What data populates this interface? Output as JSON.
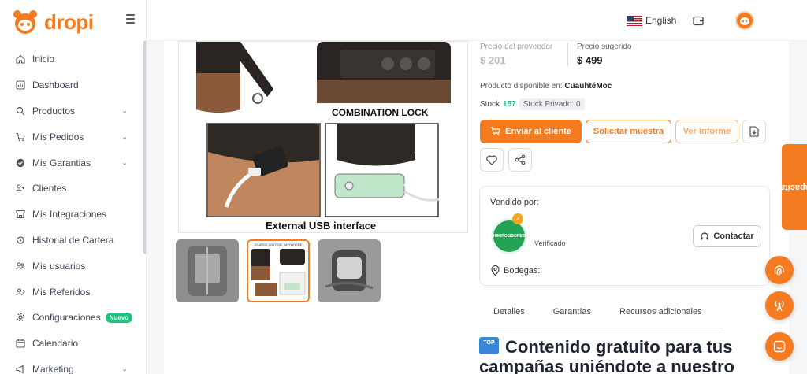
{
  "brand": {
    "name": "dropi"
  },
  "nav": {
    "items": [
      {
        "label": "Inicio",
        "icon": "home-icon",
        "chevron": false
      },
      {
        "label": "Dashboard",
        "icon": "dashboard-icon",
        "chevron": false
      },
      {
        "label": "Productos",
        "icon": "search-icon",
        "chevron": true
      },
      {
        "label": "Mis Pedidos",
        "icon": "cart-icon",
        "chevron": true
      },
      {
        "label": "Mis Garantias",
        "icon": "shield-check-icon",
        "chevron": true
      },
      {
        "label": "Clientes",
        "icon": "users-icon",
        "chevron": false
      },
      {
        "label": "Mis Integraciones",
        "icon": "store-icon",
        "chevron": false
      },
      {
        "label": "Historial de Cartera",
        "icon": "history-icon",
        "chevron": false
      },
      {
        "label": "Mis usuarios",
        "icon": "user-group-icon",
        "chevron": false
      },
      {
        "label": "Mis Referidos",
        "icon": "referral-icon",
        "chevron": false
      },
      {
        "label": "Configuraciones",
        "icon": "gear-icon",
        "chevron": false,
        "badge": "Nuevo"
      },
      {
        "label": "Calendario",
        "icon": "calendar-icon",
        "chevron": false
      },
      {
        "label": "Marketing",
        "icon": "megaphone-icon",
        "chevron": true
      }
    ]
  },
  "topbar": {
    "language": "English"
  },
  "product": {
    "image_captions": {
      "lock": "COMBINATION LOCK",
      "usb": "External USB interface"
    },
    "thumb2_caption": "CHARGE ANYTIME, ANYWHERE",
    "supplier_price_label": "Precio del proveedor",
    "supplier_price": "$ 201",
    "suggested_price_label": "Precio sugerido",
    "suggested_price": "$ 499",
    "available_label": "Producto disponible en:",
    "available_location": "CuauhtéMoc",
    "stock_label": "Stock",
    "stock_value": "157",
    "private_stock": "Stock Privado: 0"
  },
  "actions": {
    "send": "Enviar al cliente",
    "sample": "Solicitar muestra",
    "report": "Ver informe"
  },
  "seller": {
    "title": "Vendido por:",
    "logo_text": "HIMIPOSIBONES",
    "status": "Verificado",
    "contact": "Contactar",
    "warehouses_label": "Bodegas:"
  },
  "tabs": [
    "Detalles",
    "Garantías",
    "Recursos adicionales"
  ],
  "content": {
    "top_badge": "TOP",
    "heading": "Contenido gratuito para tus campañas uniéndote a nuestro"
  },
  "floating": {
    "capacitate": "¡Capacítate!"
  },
  "colors": {
    "accent": "#f47b20",
    "success": "#1fc27e"
  }
}
